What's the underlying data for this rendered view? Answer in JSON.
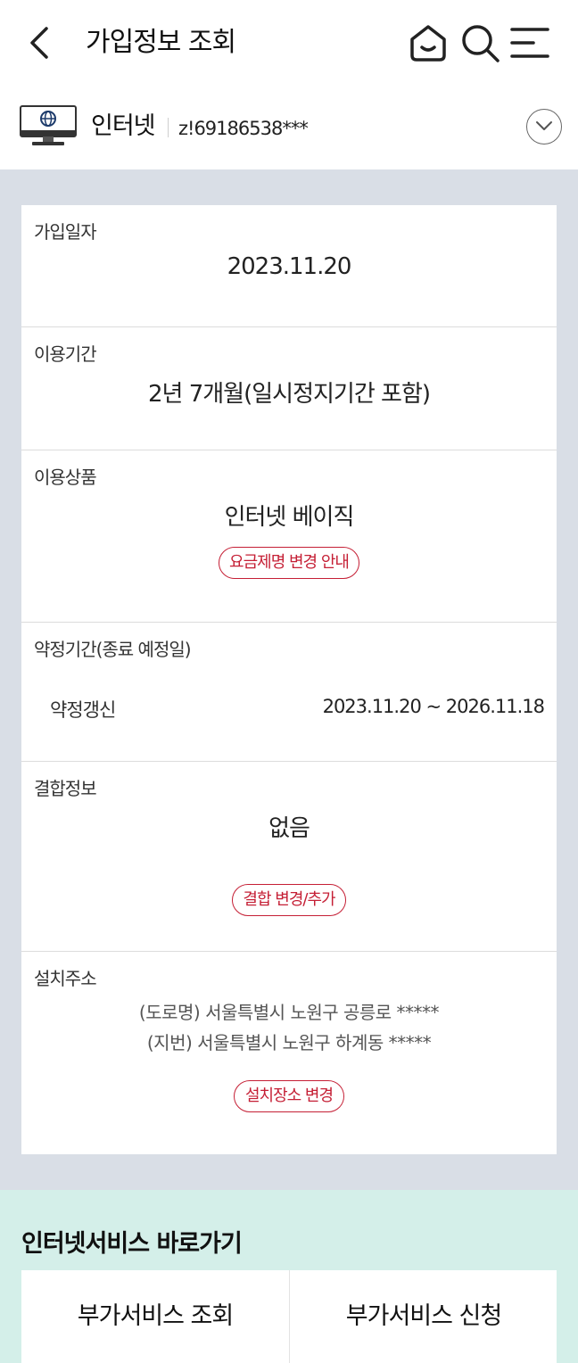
{
  "header": {
    "title": "가입정보 조회"
  },
  "product": {
    "name": "인터넷",
    "id": "z!69186538***"
  },
  "info": {
    "join_date": {
      "label": "가입일자",
      "value": "2023.11.20"
    },
    "usage_period": {
      "label": "이용기간",
      "value": "2년 7개월(일시정지기간 포함)"
    },
    "plan": {
      "label": "이용상품",
      "value": "인터넷 베이직",
      "button": "요금제명 변경 안내"
    },
    "contract": {
      "label": "약정기간(종료 예정일)",
      "type": "약정갱신",
      "period": "2023.11.20 ~ 2026.11.18"
    },
    "bundle": {
      "label": "결합정보",
      "value": "없음",
      "button": "결합 변경/추가"
    },
    "address": {
      "label": "설치주소",
      "road": "(도로명) 서울특별시 노원구 공릉로 *****",
      "lot": "(지번) 서울특별시 노원구 하계동 *****",
      "button": "설치장소 변경"
    }
  },
  "shortcuts": {
    "title": "인터넷서비스 바로가기",
    "items": [
      "부가서비스 조회",
      "부가서비스 신청"
    ]
  }
}
